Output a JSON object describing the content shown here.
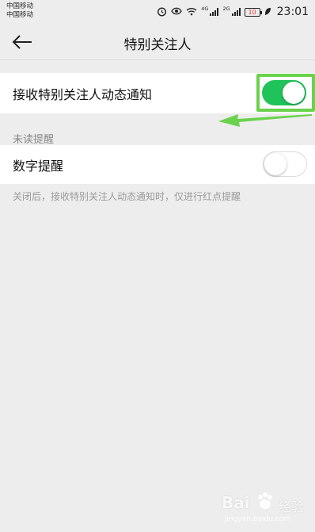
{
  "status_bar": {
    "carrier_1": "中国移动",
    "carrier_2": "中国移动",
    "network_1": "4G",
    "network_2": "2G",
    "battery": "10",
    "time": "23:01",
    "icons": [
      "alarm-icon",
      "eye-icon",
      "wifi-icon",
      "signal-icon",
      "signal-icon",
      "battery-icon",
      "leaf-icon"
    ]
  },
  "header": {
    "title": "特别关注人",
    "back_icon": "arrow-left-icon"
  },
  "settings": {
    "notify_row": {
      "label": "接收特别关注人动态通知",
      "toggle_on": true
    },
    "section_title": "未读提醒",
    "number_row": {
      "label": "数字提醒",
      "toggle_on": false
    },
    "hint": "关闭后，接收特别关注人动态通知时，仅进行红点提醒"
  },
  "colors": {
    "toggle_on": "#1fc35a",
    "highlight": "#6ad24c",
    "background": "#ededed"
  },
  "watermark": {
    "logo": "Bai",
    "text": "经验",
    "url": "jingyan.baidu.com"
  }
}
